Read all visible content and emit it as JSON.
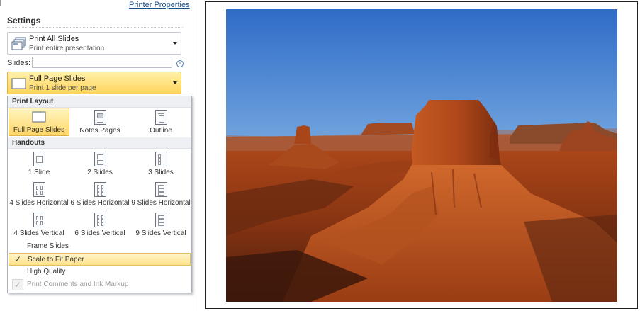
{
  "header": {
    "printer_properties": "Printer Properties"
  },
  "settings": {
    "title": "Settings",
    "print_range": {
      "title": "Print All Slides",
      "subtitle": "Print entire presentation"
    },
    "slides_label": "Slides:",
    "slides_value": "",
    "layout": {
      "title": "Full Page Slides",
      "subtitle": "Print 1 slide per page"
    }
  },
  "menu": {
    "print_layout_header": "Print Layout",
    "print_layout": [
      {
        "label": "Full Page Slides",
        "selected": true
      },
      {
        "label": "Notes Pages",
        "selected": false
      },
      {
        "label": "Outline",
        "selected": false
      }
    ],
    "handouts_header": "Handouts",
    "handouts": [
      {
        "label": "1 Slide"
      },
      {
        "label": "2 Slides"
      },
      {
        "label": "3 Slides"
      },
      {
        "label": "4 Slides Horizontal"
      },
      {
        "label": "6 Slides Horizontal"
      },
      {
        "label": "9 Slides Horizontal"
      },
      {
        "label": "4 Slides Vertical"
      },
      {
        "label": "6 Slides Vertical"
      },
      {
        "label": "9 Slides Vertical"
      }
    ],
    "options": [
      {
        "label": "Frame Slides",
        "checked": false,
        "enabled": true
      },
      {
        "label": "Scale to Fit Paper",
        "checked": true,
        "enabled": true
      },
      {
        "label": "High Quality",
        "checked": false,
        "enabled": true
      },
      {
        "label": "Print Comments and Ink Markup",
        "checked": true,
        "enabled": false
      }
    ]
  },
  "preview": {
    "image": "monument-valley-desert-photo"
  },
  "colors": {
    "highlight": "#ffd45c",
    "highlight_border": "#e3b33e",
    "link": "#1a4f8a"
  }
}
